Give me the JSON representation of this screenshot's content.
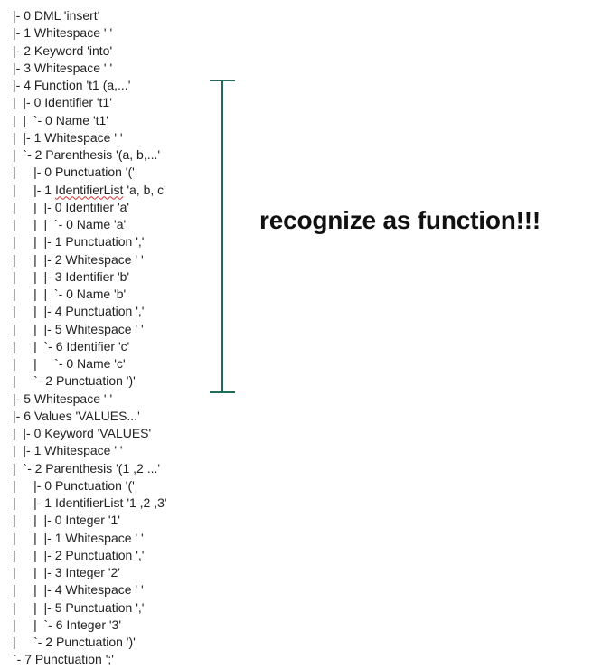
{
  "tree_lines": [
    {
      "text": "|- 0 DML 'insert'"
    },
    {
      "text": "|- 1 Whitespace ' '"
    },
    {
      "text": "|- 2 Keyword 'into'"
    },
    {
      "text": "|- 3 Whitespace ' '"
    },
    {
      "text": "|- 4 Function 't1 (a,...'"
    },
    {
      "text": "|  |- 0 Identifier 't1'"
    },
    {
      "text": "|  |  `- 0 Name 't1'"
    },
    {
      "text": "|  |- 1 Whitespace ' '"
    },
    {
      "text": "|  `- 2 Parenthesis '(a, b,...'"
    },
    {
      "text": "|     |- 0 Punctuation '('"
    },
    {
      "prefix": "|     |- 1 ",
      "squiggle": "IdentifierList",
      "suffix": " 'a, b, c'"
    },
    {
      "text": "|     |  |- 0 Identifier 'a'"
    },
    {
      "text": "|     |  |  `- 0 Name 'a'"
    },
    {
      "text": "|     |  |- 1 Punctuation ','"
    },
    {
      "text": "|     |  |- 2 Whitespace ' '"
    },
    {
      "text": "|     |  |- 3 Identifier 'b'"
    },
    {
      "text": "|     |  |  `- 0 Name 'b'"
    },
    {
      "text": "|     |  |- 4 Punctuation ','"
    },
    {
      "text": "|     |  |- 5 Whitespace ' '"
    },
    {
      "text": "|     |  `- 6 Identifier 'c'"
    },
    {
      "text": "|     |     `- 0 Name 'c'"
    },
    {
      "text": "|     `- 2 Punctuation ')'"
    },
    {
      "text": "|- 5 Whitespace ' '"
    },
    {
      "text": "|- 6 Values 'VALUES...'"
    },
    {
      "text": "|  |- 0 Keyword 'VALUES'"
    },
    {
      "text": "|  |- 1 Whitespace ' '"
    },
    {
      "text": "|  `- 2 Parenthesis '(1 ,2 ...'"
    },
    {
      "text": "|     |- 0 Punctuation '('"
    },
    {
      "text": "|     |- 1 IdentifierList '1 ,2 ,3'"
    },
    {
      "text": "|     |  |- 0 Integer '1'"
    },
    {
      "text": "|     |  |- 1 Whitespace ' '"
    },
    {
      "text": "|     |  |- 2 Punctuation ','"
    },
    {
      "text": "|     |  |- 3 Integer '2'"
    },
    {
      "text": "|     |  |- 4 Whitespace ' '"
    },
    {
      "text": "|     |  |- 5 Punctuation ','"
    },
    {
      "text": "|     |  `- 6 Integer '3'"
    },
    {
      "text": "|     `- 2 Punctuation ')'"
    },
    {
      "text": "`- 7 Punctuation ';'"
    }
  ],
  "annotation": {
    "label": "recognize as function!!!",
    "bracket_color": "#1f6b5c",
    "squiggle_color": "#d32f2f"
  }
}
